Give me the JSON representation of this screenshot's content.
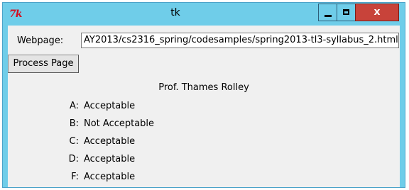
{
  "window": {
    "title": "tk",
    "app_icon": "tk-feather-icon",
    "app_icon_text": "7k",
    "controls": {
      "minimize_icon": "minimize-icon",
      "maximize_icon": "maximize-icon",
      "close_icon": "close-icon",
      "close_glyph": "x"
    },
    "colors": {
      "titlebar": "#6fcde9",
      "close_button": "#c8433a",
      "client_background": "#f0f0f0",
      "icon_red": "#d10e20"
    }
  },
  "form": {
    "webpage_label": "Webpage:",
    "webpage_value": "AY2013/cs2316_spring/codesamples/spring2013-tl3-syllabus_2.html",
    "process_button_label": "Process Page"
  },
  "results": {
    "professor": "Prof. Thames Rolley",
    "grades": [
      {
        "letter": "A:",
        "status": "Acceptable"
      },
      {
        "letter": "B:",
        "status": "Not Acceptable"
      },
      {
        "letter": "C:",
        "status": "Acceptable"
      },
      {
        "letter": "D:",
        "status": "Acceptable"
      },
      {
        "letter": "F:",
        "status": "Acceptable"
      }
    ]
  }
}
